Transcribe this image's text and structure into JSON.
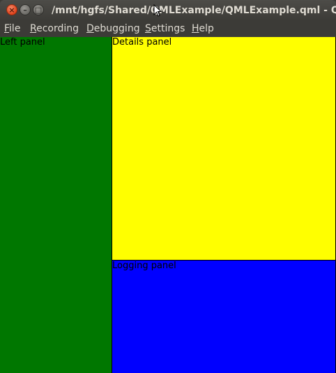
{
  "window": {
    "title": "/mnt/hgfs/Shared/QMLExample/QMLExample.qml - Q",
    "buttons": {
      "close": "×",
      "minimize": "–",
      "maximize": "□"
    }
  },
  "menubar": {
    "items": [
      {
        "mnemonic": "F",
        "rest": "ile"
      },
      {
        "mnemonic": "R",
        "rest": "ecording"
      },
      {
        "mnemonic": "D",
        "rest": "ebugging"
      },
      {
        "mnemonic": "S",
        "rest": "ettings"
      },
      {
        "mnemonic": "H",
        "rest": "elp"
      }
    ]
  },
  "panels": {
    "left": {
      "label": "Left panel",
      "color": "#007700"
    },
    "details": {
      "label": "Details panel",
      "color": "#ffff00"
    },
    "logging": {
      "label": "Logging panel",
      "color": "#0000ff"
    }
  },
  "icons": {
    "cursor": "mouse-pointer-icon"
  }
}
